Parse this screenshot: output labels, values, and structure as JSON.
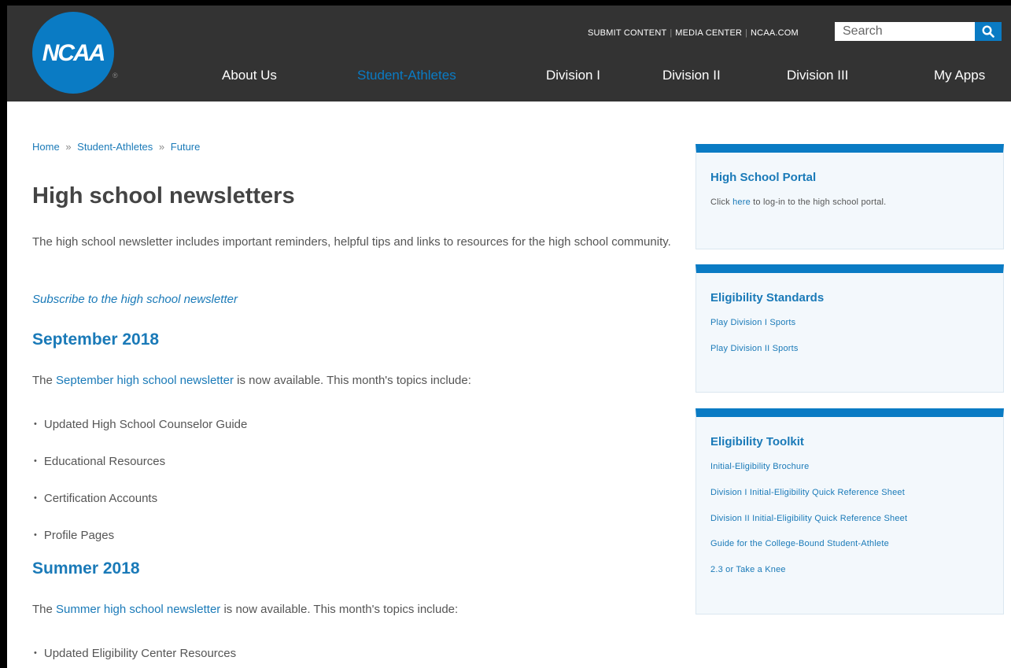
{
  "header": {
    "logo_text": "NCAA",
    "logo_registered": "®",
    "utility_links": [
      "SUBMIT CONTENT",
      "MEDIA CENTER",
      "NCAA.COM"
    ],
    "search_placeholder": "Search",
    "nav": [
      {
        "label": "About Us",
        "active": false
      },
      {
        "label": "Student-Athletes",
        "active": true
      },
      {
        "label": "Division I",
        "active": false
      },
      {
        "label": "Division II",
        "active": false
      },
      {
        "label": "Division III",
        "active": false
      },
      {
        "label": "My Apps",
        "active": false
      }
    ]
  },
  "breadcrumb": [
    "Home",
    "Student-Athletes",
    "Future"
  ],
  "breadcrumb_separator": "»",
  "page_title": "High school newsletters",
  "intro": "The high school newsletter includes important reminders, helpful tips and links to resources for the high school community.",
  "subscribe_link": "Subscribe to the high school newsletter",
  "sections": [
    {
      "heading": "September 2018",
      "text_prefix": "The ",
      "link": "September high school newsletter",
      "text_suffix": " is now available. This month's topics include:",
      "bullets": [
        "Updated High School Counselor Guide",
        "Educational Resources",
        "Certification Accounts",
        "Profile Pages"
      ]
    },
    {
      "heading": "Summer 2018",
      "text_prefix": "The ",
      "link": "Summer high school newsletter",
      "text_suffix": " is now available. This month's topics include:",
      "bullets": [
        "Updated Eligibility Center Resources"
      ]
    }
  ],
  "sidebar": {
    "high_school_portal": {
      "title": "High School Portal",
      "text_prefix": "Click ",
      "link": "here",
      "text_suffix": " to log-in to the high school portal."
    },
    "eligibility_standards": {
      "title": "Eligibility Standards",
      "links": [
        "Play Division I Sports",
        "Play Division II Sports"
      ]
    },
    "eligibility_toolkit": {
      "title": "Eligibility Toolkit",
      "links": [
        "Initial-Eligibility Brochure",
        "Division I Initial-Eligibility Quick Reference Sheet",
        "Division II Initial-Eligibility Quick Reference Sheet",
        "Guide for the College-Bound Student-Athlete",
        "2.3 or Take a Knee"
      ]
    }
  },
  "colors": {
    "header_bg": "#333333",
    "brand_blue": "#0a7bc4",
    "link_blue": "#1a7ab8",
    "body_text": "#555555"
  }
}
